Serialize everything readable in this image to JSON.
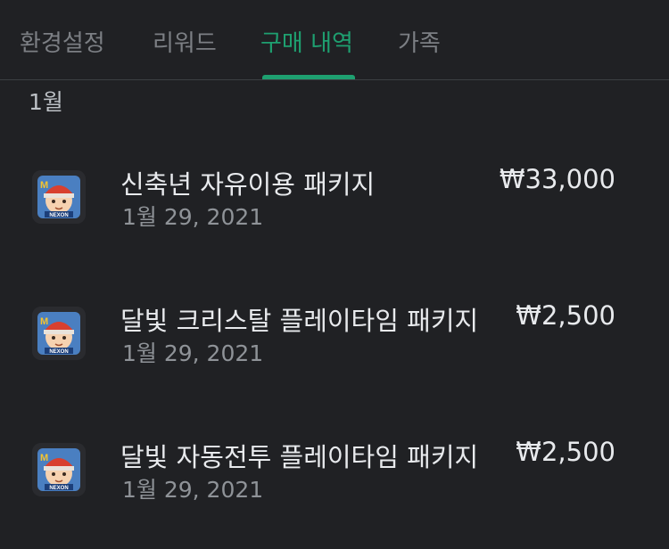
{
  "tabs": [
    {
      "label": "환경설정",
      "active": false
    },
    {
      "label": "리워드",
      "active": false
    },
    {
      "label": "구매 내역",
      "active": true
    },
    {
      "label": "가족",
      "active": false
    }
  ],
  "section": {
    "month_label": "1월"
  },
  "purchases": [
    {
      "icon": "nexon-game-app-icon",
      "title": "신축년 자유이용 패키지",
      "price": "₩33,000",
      "date": "1월 29, 2021"
    },
    {
      "icon": "nexon-game-app-icon",
      "title": "달빛 크리스탈 플레이타임 패키지",
      "price": "₩2,500",
      "date": "1월 29, 2021"
    },
    {
      "icon": "nexon-game-app-icon",
      "title": "달빛 자동전투 플레이타임 패키지",
      "price": "₩2,500",
      "date": "1월 29, 2021"
    }
  ],
  "icon_wordmark": "NEXON",
  "icon_letter": "M",
  "colors": {
    "background": "#202124",
    "accent": "#1ea070",
    "text_primary": "#e8eaed",
    "text_secondary": "#8f9398",
    "tab_inactive": "#7c7f84"
  }
}
